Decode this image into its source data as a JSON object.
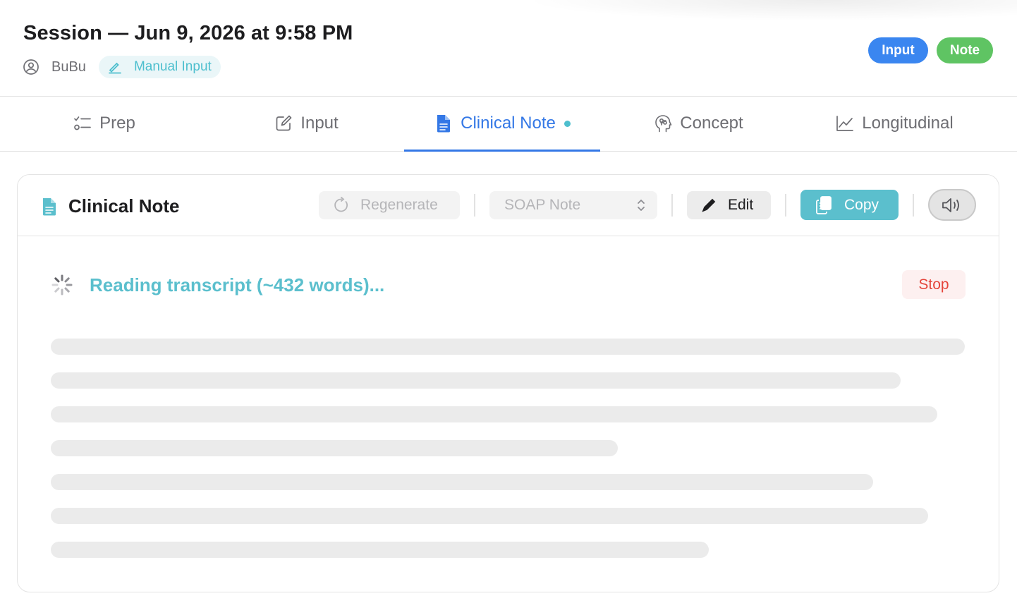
{
  "header": {
    "title": "Session — Jun 9, 2026 at 9:58 PM",
    "user_name": "BuBu",
    "source_chip": "Manual Input",
    "pills": {
      "input": "Input",
      "note": "Note"
    }
  },
  "tabs": [
    {
      "label": "Prep",
      "icon": "checklist-icon"
    },
    {
      "label": "Input",
      "icon": "edit-square-icon"
    },
    {
      "label": "Clinical Note",
      "icon": "document-icon",
      "active": true,
      "has_dot": true
    },
    {
      "label": "Concept",
      "icon": "brain-head-icon"
    },
    {
      "label": "Longitudinal",
      "icon": "line-chart-icon"
    }
  ],
  "card": {
    "title": "Clinical Note",
    "toolbar": {
      "regenerate": "Regenerate",
      "note_type": "SOAP Note",
      "edit": "Edit",
      "copy": "Copy"
    },
    "status": "Reading transcript (~432 words)...",
    "stop": "Stop",
    "skeleton_line_fractions": [
      1.0,
      0.93,
      0.97,
      0.62,
      0.9,
      0.96,
      0.72
    ]
  },
  "colors": {
    "accent_blue": "#3478e6",
    "input_pill": "#3a86f0",
    "note_pill": "#5fc463",
    "teal": "#5bbfcd",
    "stop_red": "#e5453b"
  }
}
